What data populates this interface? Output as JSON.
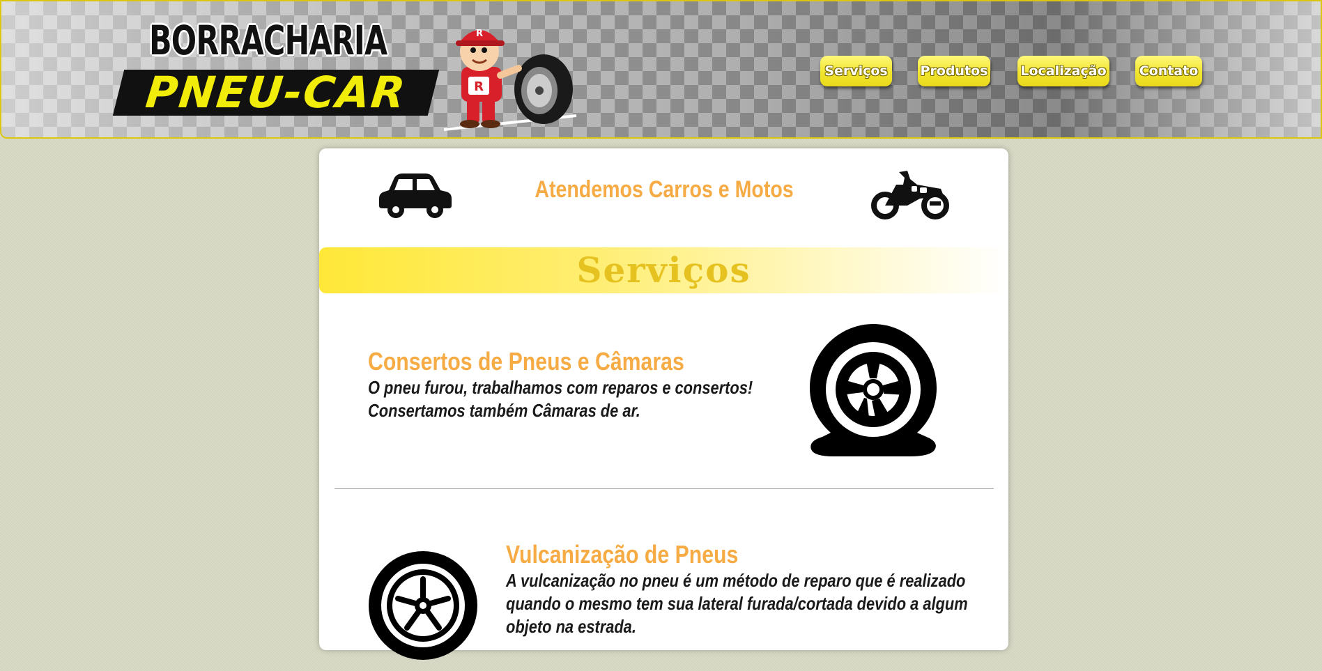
{
  "header": {
    "logo_top": "BORRACHARIA",
    "logo_bottom": "PNEU-CAR",
    "mascot_letter": "R",
    "nav": [
      "Serviços",
      "Produtos",
      "Localização",
      "Contato"
    ]
  },
  "main": {
    "attend_title": "Atendemos Carros e Motos",
    "section_title": "Serviços",
    "services": [
      {
        "title": "Consertos de Pneus e Câmaras",
        "desc": "O pneu furou, trabalhamos com reparos e consertos! Consertamos também Câmaras de ar."
      },
      {
        "title": "Vulcanização de Pneus",
        "desc": "A vulcanização no pneu é um método de reparo que é realizado quando o mesmo tem sua lateral furada/cortada devido a algum objeto na estrada."
      }
    ]
  },
  "colors": {
    "accent_orange": "#f6ab44",
    "brand_yellow": "#f1ec0a",
    "nav_yellow": "#f2e52e",
    "section_title": "#e6c221"
  },
  "icons": [
    "car-icon",
    "motorcycle-icon",
    "flat-tire-icon",
    "tire-repair-icon"
  ]
}
